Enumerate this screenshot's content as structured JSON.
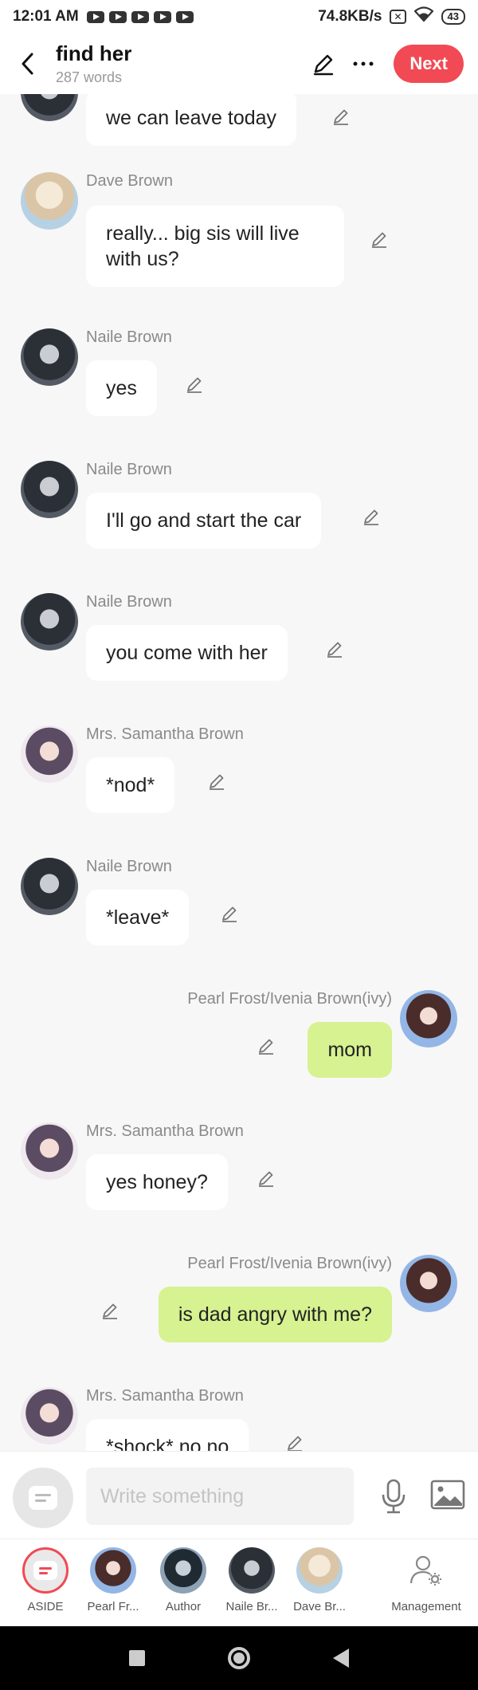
{
  "status_bar": {
    "time": "12:01 AM",
    "speed": "74.8KB/s",
    "battery": "43"
  },
  "header": {
    "title": "find her",
    "word_count": "287 words",
    "next_label": "Next"
  },
  "messages": [
    {
      "sender": "",
      "text": "we can leave today",
      "side": "left",
      "avatar": "naile"
    },
    {
      "sender": "Dave Brown",
      "text": "really... big sis will live with us?",
      "side": "left",
      "avatar": "dave"
    },
    {
      "sender": "Naile Brown",
      "text": "yes",
      "side": "left",
      "avatar": "naile"
    },
    {
      "sender": "Naile Brown",
      "text": "I'll go and start the car",
      "side": "left",
      "avatar": "naile"
    },
    {
      "sender": "Naile Brown",
      "text": "you come with her",
      "side": "left",
      "avatar": "naile"
    },
    {
      "sender": "Mrs. Samantha Brown",
      "text": "*nod*",
      "side": "left",
      "avatar": "sam"
    },
    {
      "sender": "Naile Brown",
      "text": "*leave*",
      "side": "left",
      "avatar": "naile"
    },
    {
      "sender": "Pearl Frost/Ivenia Brown(ivy)",
      "text": "mom",
      "side": "right",
      "avatar": "pearl"
    },
    {
      "sender": "Mrs. Samantha Brown",
      "text": "yes honey?",
      "side": "left",
      "avatar": "sam"
    },
    {
      "sender": "Pearl Frost/Ivenia Brown(ivy)",
      "text": "is dad angry with me?",
      "side": "right",
      "avatar": "pearl"
    },
    {
      "sender": "Mrs. Samantha Brown",
      "text": "*shock* no no",
      "side": "left",
      "avatar": "sam"
    }
  ],
  "input": {
    "placeholder": "Write something"
  },
  "characters": [
    {
      "label": "ASIDE"
    },
    {
      "label": "Pearl Fr..."
    },
    {
      "label": "Author"
    },
    {
      "label": "Naile Br..."
    },
    {
      "label": "Dave Br..."
    },
    {
      "label": "Management"
    }
  ],
  "colors": {
    "accent": "#f14a54",
    "my_bubble": "#d6f291",
    "other_bubble": "#ffffff",
    "background": "#f7f7f7"
  }
}
